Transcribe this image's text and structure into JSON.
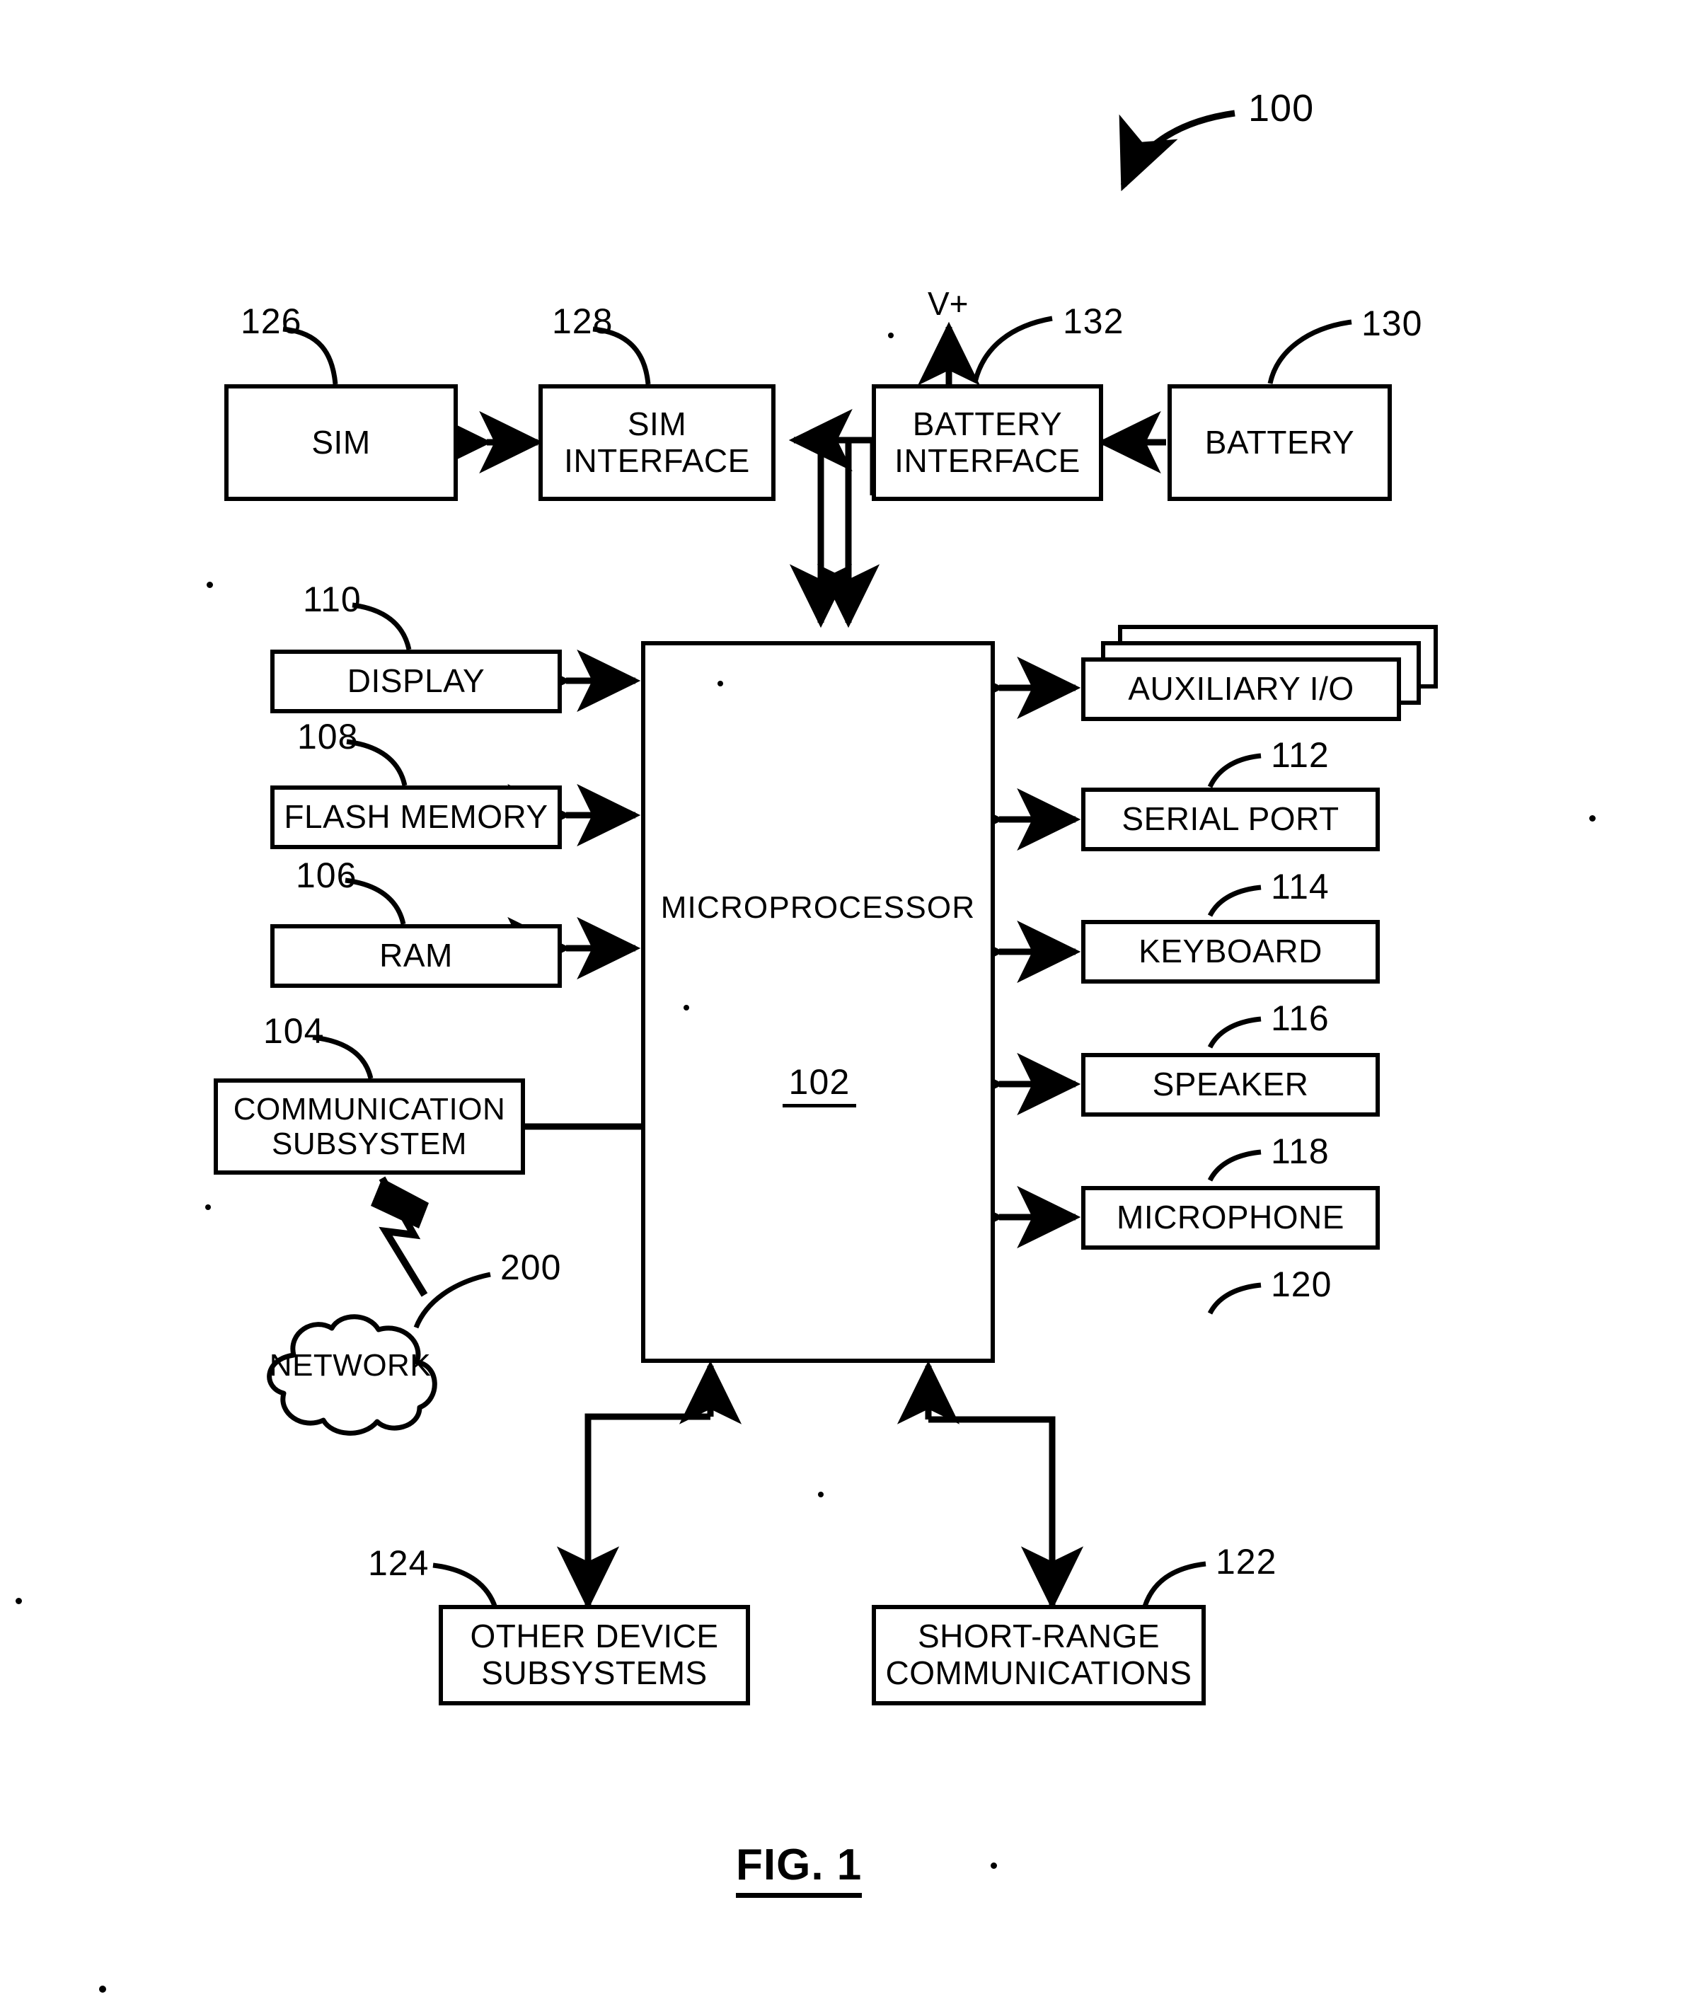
{
  "figure": {
    "caption": "FIG. 1",
    "system_ref": "100",
    "power_label": "V+"
  },
  "blocks": [
    {
      "id": "sim",
      "label": "SIM",
      "ref": "126"
    },
    {
      "id": "sim_if",
      "label": "SIM\nINTERFACE",
      "ref": "128"
    },
    {
      "id": "batt_if",
      "label": "BATTERY\nINTERFACE",
      "ref": "132"
    },
    {
      "id": "battery",
      "label": "BATTERY",
      "ref": "130"
    },
    {
      "id": "display",
      "label": "DISPLAY",
      "ref": "110"
    },
    {
      "id": "flash",
      "label": "FLASH MEMORY",
      "ref": "108"
    },
    {
      "id": "ram",
      "label": "RAM",
      "ref": "106"
    },
    {
      "id": "comm",
      "label": "COMMUNICATION\nSUBSYSTEM",
      "ref": "104"
    },
    {
      "id": "network",
      "label": "NETWORK",
      "ref": "200"
    },
    {
      "id": "micro",
      "label": "MICROPROCESSOR",
      "ref": "102"
    },
    {
      "id": "auxio",
      "label": "AUXILIARY I/O",
      "ref": "112"
    },
    {
      "id": "serial",
      "label": "SERIAL PORT",
      "ref": "114"
    },
    {
      "id": "keyboard",
      "label": "KEYBOARD",
      "ref": "116"
    },
    {
      "id": "speaker",
      "label": "SPEAKER",
      "ref": "118"
    },
    {
      "id": "microphone",
      "label": "MICROPHONE",
      "ref": "120"
    },
    {
      "id": "other",
      "label": "OTHER DEVICE\nSUBSYSTEMS",
      "ref": "124"
    },
    {
      "id": "shortrange",
      "label": "SHORT-RANGE\nCOMMUNICATIONS",
      "ref": "122"
    }
  ],
  "colors": {
    "ink": "#000000",
    "paper": "#ffffff"
  }
}
